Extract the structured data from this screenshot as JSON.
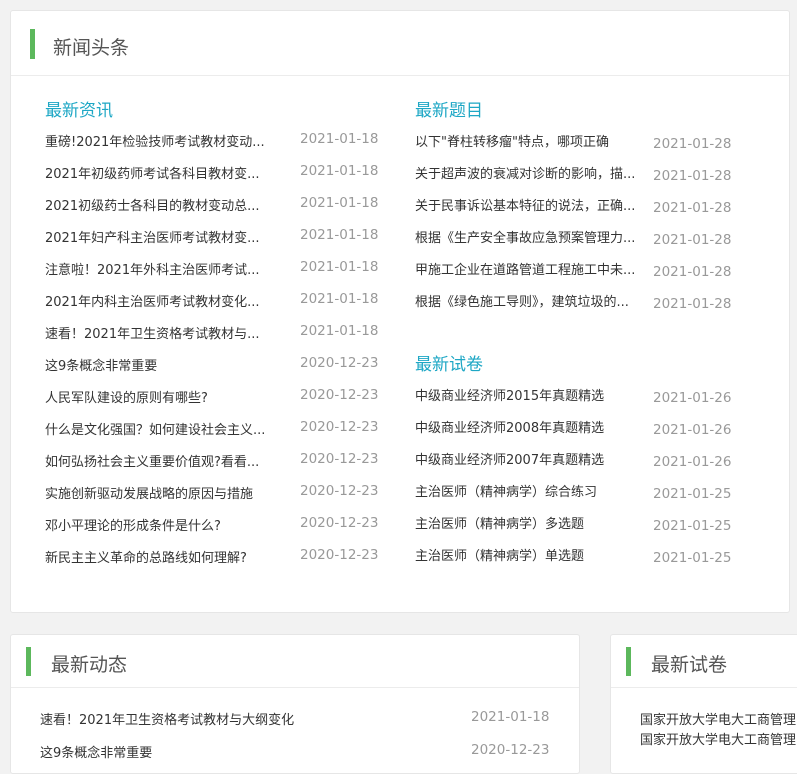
{
  "headlines_panel": {
    "title": "新闻头条",
    "latest_news": {
      "heading": "最新资讯",
      "items": [
        {
          "title": "重磅!2021年检验技师考试教材变动...",
          "date": "2021-01-18"
        },
        {
          "title": "2021年初级药师考试各科目教材变...",
          "date": "2021-01-18"
        },
        {
          "title": "2021初级药士各科目的教材变动总...",
          "date": "2021-01-18"
        },
        {
          "title": "2021年妇产科主治医师考试教材变...",
          "date": "2021-01-18"
        },
        {
          "title": "注意啦！2021年外科主治医师考试...",
          "date": "2021-01-18"
        },
        {
          "title": "2021年内科主治医师考试教材变化...",
          "date": "2021-01-18"
        },
        {
          "title": "速看！2021年卫生资格考试教材与...",
          "date": "2021-01-18"
        },
        {
          "title": "这9条概念非常重要",
          "date": "2020-12-23"
        },
        {
          "title": "人民军队建设的原则有哪些?",
          "date": "2020-12-23"
        },
        {
          "title": "什么是文化强国？如何建设社会主义...",
          "date": "2020-12-23"
        },
        {
          "title": "如何弘扬社会主义重要价值观?看看...",
          "date": "2020-12-23"
        },
        {
          "title": "实施创新驱动发展战略的原因与措施",
          "date": "2020-12-23"
        },
        {
          "title": "邓小平理论的形成条件是什么?",
          "date": "2020-12-23"
        },
        {
          "title": "新民主主义革命的总路线如何理解?",
          "date": "2020-12-23"
        }
      ]
    },
    "latest_questions": {
      "heading": "最新题目",
      "items": [
        {
          "title": "以下\"脊柱转移瘤\"特点，哪项正确",
          "date": "2021-01-28"
        },
        {
          "title": "关于超声波的衰减对诊断的影响，描...",
          "date": "2021-01-28"
        },
        {
          "title": "关于民事诉讼基本特征的说法，正确...",
          "date": "2021-01-28"
        },
        {
          "title": "根据《生产安全事故应急预案管理力...",
          "date": "2021-01-28"
        },
        {
          "title": "甲施工企业在道路管道工程施工中未...",
          "date": "2021-01-28"
        },
        {
          "title": "根据《绿色施工导则》，建筑垃圾的...",
          "date": "2021-01-28"
        }
      ]
    },
    "latest_papers": {
      "heading": "最新试卷",
      "items": [
        {
          "title": "中级商业经济师2015年真题精选",
          "date": "2021-01-26"
        },
        {
          "title": "中级商业经济师2008年真题精选",
          "date": "2021-01-26"
        },
        {
          "title": "中级商业经济师2007年真题精选",
          "date": "2021-01-26"
        },
        {
          "title": "主治医师（精神病学）综合练习",
          "date": "2021-01-25"
        },
        {
          "title": "主治医师（精神病学）多选题",
          "date": "2021-01-25"
        },
        {
          "title": "主治医师（精神病学）单选题",
          "date": "2021-01-25"
        }
      ]
    }
  },
  "dynamics_panel": {
    "title": "最新动态",
    "items": [
      {
        "title": "速看！2021年卫生资格考试教材与大纲变化",
        "date": "2021-01-18"
      },
      {
        "title": "这9条概念非常重要",
        "date": "2020-12-23"
      }
    ]
  },
  "papers_panel": {
    "title": "最新试卷",
    "items": [
      {
        "title": "国家开放大学电大工商管理"
      },
      {
        "title": "国家开放大学电大工商管理"
      }
    ]
  },
  "colors": {
    "accent": "#5cb85c",
    "section_heading": "#1ea7c5",
    "date": "#999999"
  }
}
